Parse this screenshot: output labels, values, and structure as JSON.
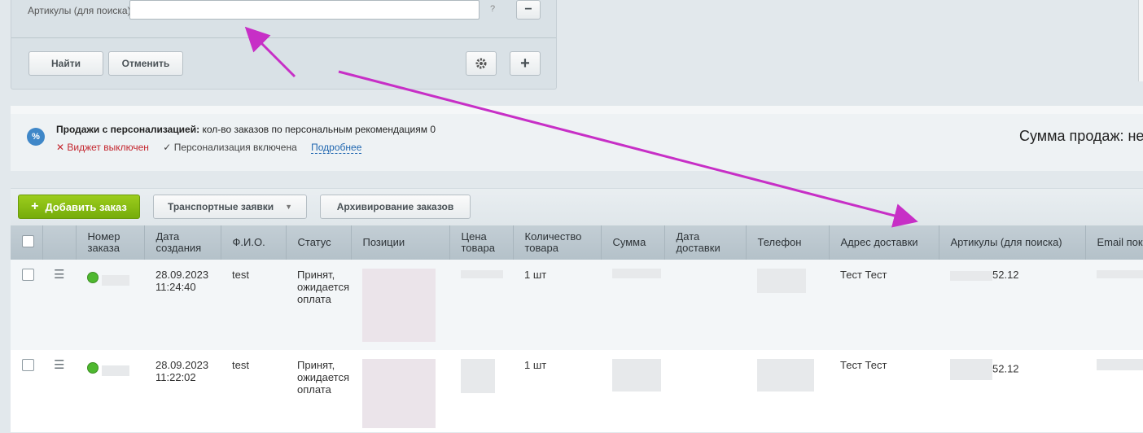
{
  "filter": {
    "label": "Артикулы (для поиска):",
    "input_value": "",
    "help": "?",
    "remove": "−",
    "find_button": "Найти",
    "cancel_button": "Отменить",
    "settings_icon": "gear-icon",
    "add_icon": "+"
  },
  "promo": {
    "title_bold": "Продажи с персонализацией:",
    "title_rest": "кол-во заказов по персональным рекомендациям 0",
    "widget_off": "Виджет выключен",
    "personalization_on": "Персонализация включена",
    "more_link": "Подробнее",
    "sales_sum": "Сумма продаж: не"
  },
  "toolbar": {
    "add_order": "Добавить заказ",
    "transport": "Транспортные заявки",
    "archive": "Архивирование заказов"
  },
  "table": {
    "headers": [
      "Номер заказа",
      "Дата создания",
      "Ф.И.О.",
      "Статус",
      "Позиции",
      "Цена товара",
      "Количество товара",
      "Сумма",
      "Дата доставки",
      "Телефон",
      "Адрес доставки",
      "Артикулы (для поиска)",
      "Email пок"
    ],
    "rows": [
      {
        "date": "28.09.2023 11:24:40",
        "fio": "test",
        "status": "Принят, ожидается оплата",
        "quantity": "1 шт",
        "address": "Тест Тест",
        "articles_suffix": "52.12"
      },
      {
        "date": "28.09.2023 11:22:02",
        "fio": "test",
        "status": "Принят, ожидается оплата",
        "quantity": "1 шт",
        "address": "Тест Тест",
        "articles_suffix": "52.12"
      }
    ]
  },
  "colors": {
    "annotation_arrow": "#c72fc6",
    "add_button": "#85bb12",
    "status_dot": "#4eb82f"
  }
}
